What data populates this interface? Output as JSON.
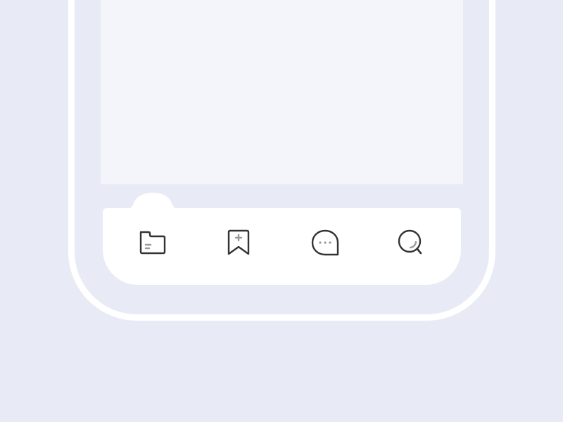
{
  "colors": {
    "background": "#e8ebf5",
    "frame": "#ffffff",
    "screen": "#f3f5fa",
    "tab_bar": "#ffffff",
    "icon_stroke": "#333333",
    "icon_accent": "#9a9a9a"
  },
  "tab_bar": {
    "active_tab": "files",
    "tabs": [
      {
        "id": "files",
        "icon": "folder-icon"
      },
      {
        "id": "bookmark",
        "icon": "bookmark-add-icon"
      },
      {
        "id": "chat",
        "icon": "chat-bubble-icon"
      },
      {
        "id": "search",
        "icon": "search-icon"
      }
    ]
  }
}
